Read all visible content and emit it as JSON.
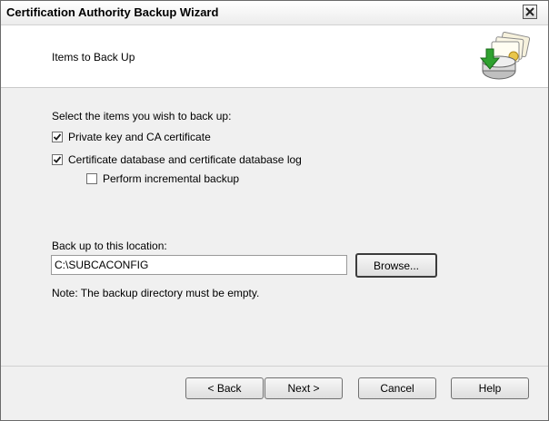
{
  "window": {
    "title": "Certification Authority Backup Wizard"
  },
  "header": {
    "title": "Items to Back Up"
  },
  "form": {
    "prompt": "Select the items you wish to back up:",
    "options": [
      {
        "label": "Private key and CA certificate",
        "checked": true
      },
      {
        "label": "Certificate database and certificate database log",
        "checked": true
      },
      {
        "label": "Perform incremental backup",
        "checked": false
      }
    ],
    "location_label": "Back up to this location:",
    "location_value": "C:\\SUBCACONFIG",
    "browse_label": "Browse...",
    "note": "Note: The backup directory must be empty."
  },
  "footer": {
    "back_label": "< Back",
    "next_label": "Next >",
    "cancel_label": "Cancel",
    "help_label": "Help"
  },
  "icons": {
    "close": "close-icon",
    "wizard": "backup-wizard-icon",
    "check": "checkmark-icon"
  }
}
